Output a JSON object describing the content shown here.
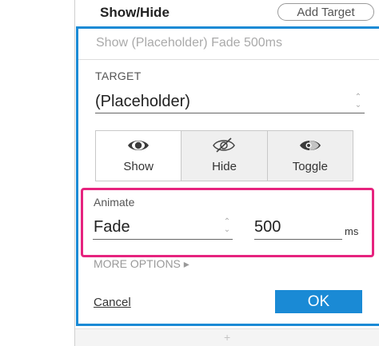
{
  "header": {
    "title": "Show/Hide",
    "add_target_label": "Add Target"
  },
  "summary": "Show (Placeholder) Fade 500ms",
  "target": {
    "label": "TARGET",
    "value": "(Placeholder)"
  },
  "actions": [
    {
      "label": "Show",
      "icon": "eye-icon",
      "selected": true
    },
    {
      "label": "Hide",
      "icon": "eye-slash-icon",
      "selected": false
    },
    {
      "label": "Toggle",
      "icon": "eye-half-icon",
      "selected": false
    }
  ],
  "animate": {
    "label": "Animate",
    "effect": "Fade",
    "duration": "500",
    "unit": "ms"
  },
  "more_options": "MORE OPTIONS ▸",
  "footer": {
    "cancel_label": "Cancel",
    "ok_label": "OK"
  },
  "bottom": {
    "add_icon": "+"
  },
  "colors": {
    "accent": "#1a8ad5",
    "highlight": "#e6237e"
  }
}
